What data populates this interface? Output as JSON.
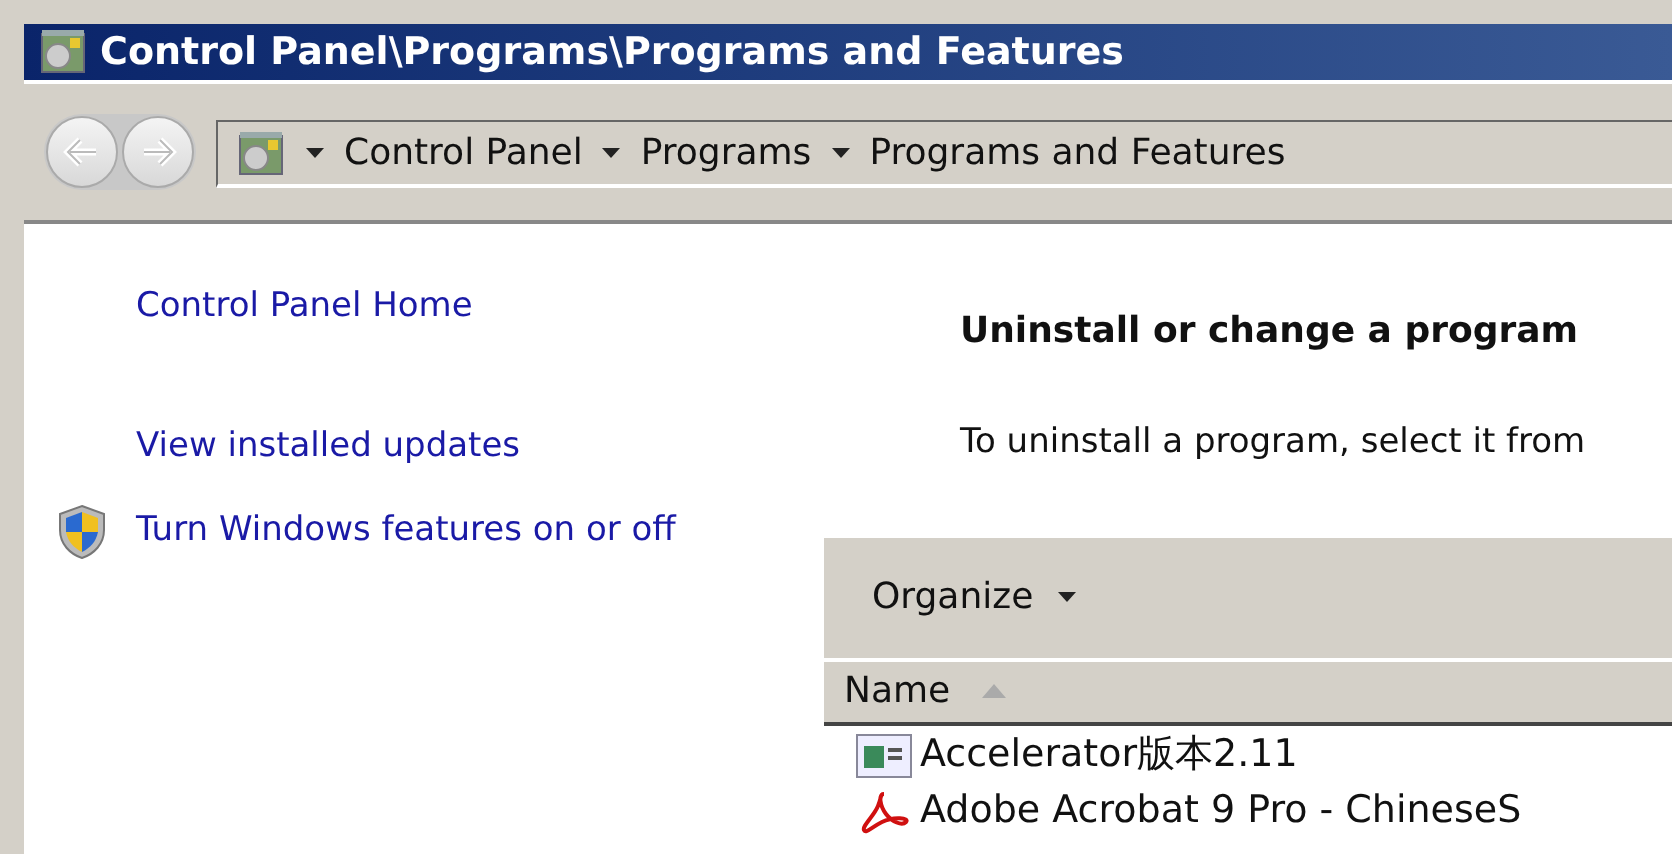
{
  "window": {
    "title": "Control Panel\\Programs\\Programs and Features"
  },
  "address_bar": {
    "crumbs": [
      "Control Panel",
      "Programs",
      "Programs and Features"
    ]
  },
  "sidebar": {
    "items": [
      {
        "label": "Control Panel Home",
        "kind": "plain"
      },
      {
        "label": "View installed updates",
        "kind": "plain"
      },
      {
        "label": "Turn Windows features on or off",
        "kind": "shield"
      }
    ]
  },
  "main": {
    "heading": "Uninstall or change a program",
    "description": "To uninstall a program, select it from"
  },
  "toolbar": {
    "organize": "Organize"
  },
  "table": {
    "columns": [
      {
        "label": "Name",
        "sorted": true
      }
    ],
    "rows": [
      {
        "name": "Accelerator版本2.11",
        "kind": "app"
      },
      {
        "name": "Adobe Acrobat 9 Pro - ChineseS",
        "kind": "pdf"
      }
    ]
  }
}
